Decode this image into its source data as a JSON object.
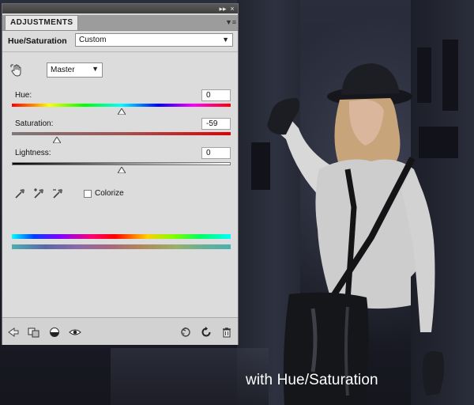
{
  "panel": {
    "title": "ADJUSTMENTS",
    "adjustment_name": "Hue/Saturation",
    "preset_value": "Custom",
    "channel_value": "Master",
    "sliders": [
      {
        "label": "Hue:",
        "value": "0",
        "level": 0.5
      },
      {
        "label": "Saturation:",
        "value": "-59",
        "level": 0.205
      },
      {
        "label": "Lightness:",
        "value": "0",
        "level": 0.5
      }
    ],
    "colorize_label": "Colorize",
    "colorize_checked": false,
    "icons": {
      "collapse": "double-right-arrow-icon",
      "close": "close-icon",
      "menu": "panel-menu-icon",
      "hand": "targeted-adjustment-hand-icon",
      "eyedroppers": [
        "eyedropper-icon",
        "eyedropper-plus-icon",
        "eyedropper-minus-icon"
      ],
      "footer": [
        "back-arrow-icon",
        "clip-to-layer-icon",
        "visibility-eye-icon",
        "eye-icon",
        "view-previous-icon",
        "reset-icon",
        "trash-icon"
      ]
    }
  },
  "caption": "with Hue/Saturation",
  "colors": {
    "panel_bg": "#dcdcdc",
    "panel_header": "#4a4a4a",
    "saturation_track_end": "#e10000"
  }
}
